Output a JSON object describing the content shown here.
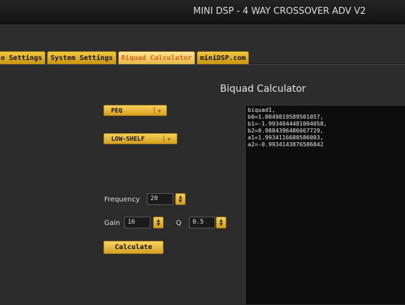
{
  "window": {
    "title": "MINI DSP - 4 WAY CROSSOVER ADV V2"
  },
  "tabs": [
    {
      "label": "o Settings",
      "active": false
    },
    {
      "label": "System Settings",
      "active": false
    },
    {
      "label": "Biquad Calculator",
      "active": true
    },
    {
      "label": "miniDSP.com",
      "active": false
    }
  ],
  "calculator": {
    "heading": "Biquad Calculator",
    "filter_type": {
      "selected": "PEQ"
    },
    "shelf_type": {
      "selected": "LOW-SHELF"
    },
    "frequency": {
      "label": "Frequency",
      "value": "20"
    },
    "gain": {
      "label": "Gain",
      "value": "16"
    },
    "q": {
      "label": "Q",
      "value": "0.5"
    },
    "calculate_label": "Calculate",
    "output_lines": [
      "biquad1,",
      "b0=1.0049819589501057,",
      "b1=-1.9934044481004058,",
      "b2=0.9884396486667729,",
      "a1=1.9934116680586003,",
      "a2=-0.9934143876586842"
    ]
  },
  "icons": {
    "dropdown": "chevron-down-icon",
    "spin_up": "triangle-up-icon",
    "spin_down": "triangle-down-icon"
  },
  "colors": {
    "accent": "#e8b02b",
    "active_tab_text": "#d5671a",
    "background": "#2b2b2b",
    "output_bg": "#0d0d0d"
  }
}
